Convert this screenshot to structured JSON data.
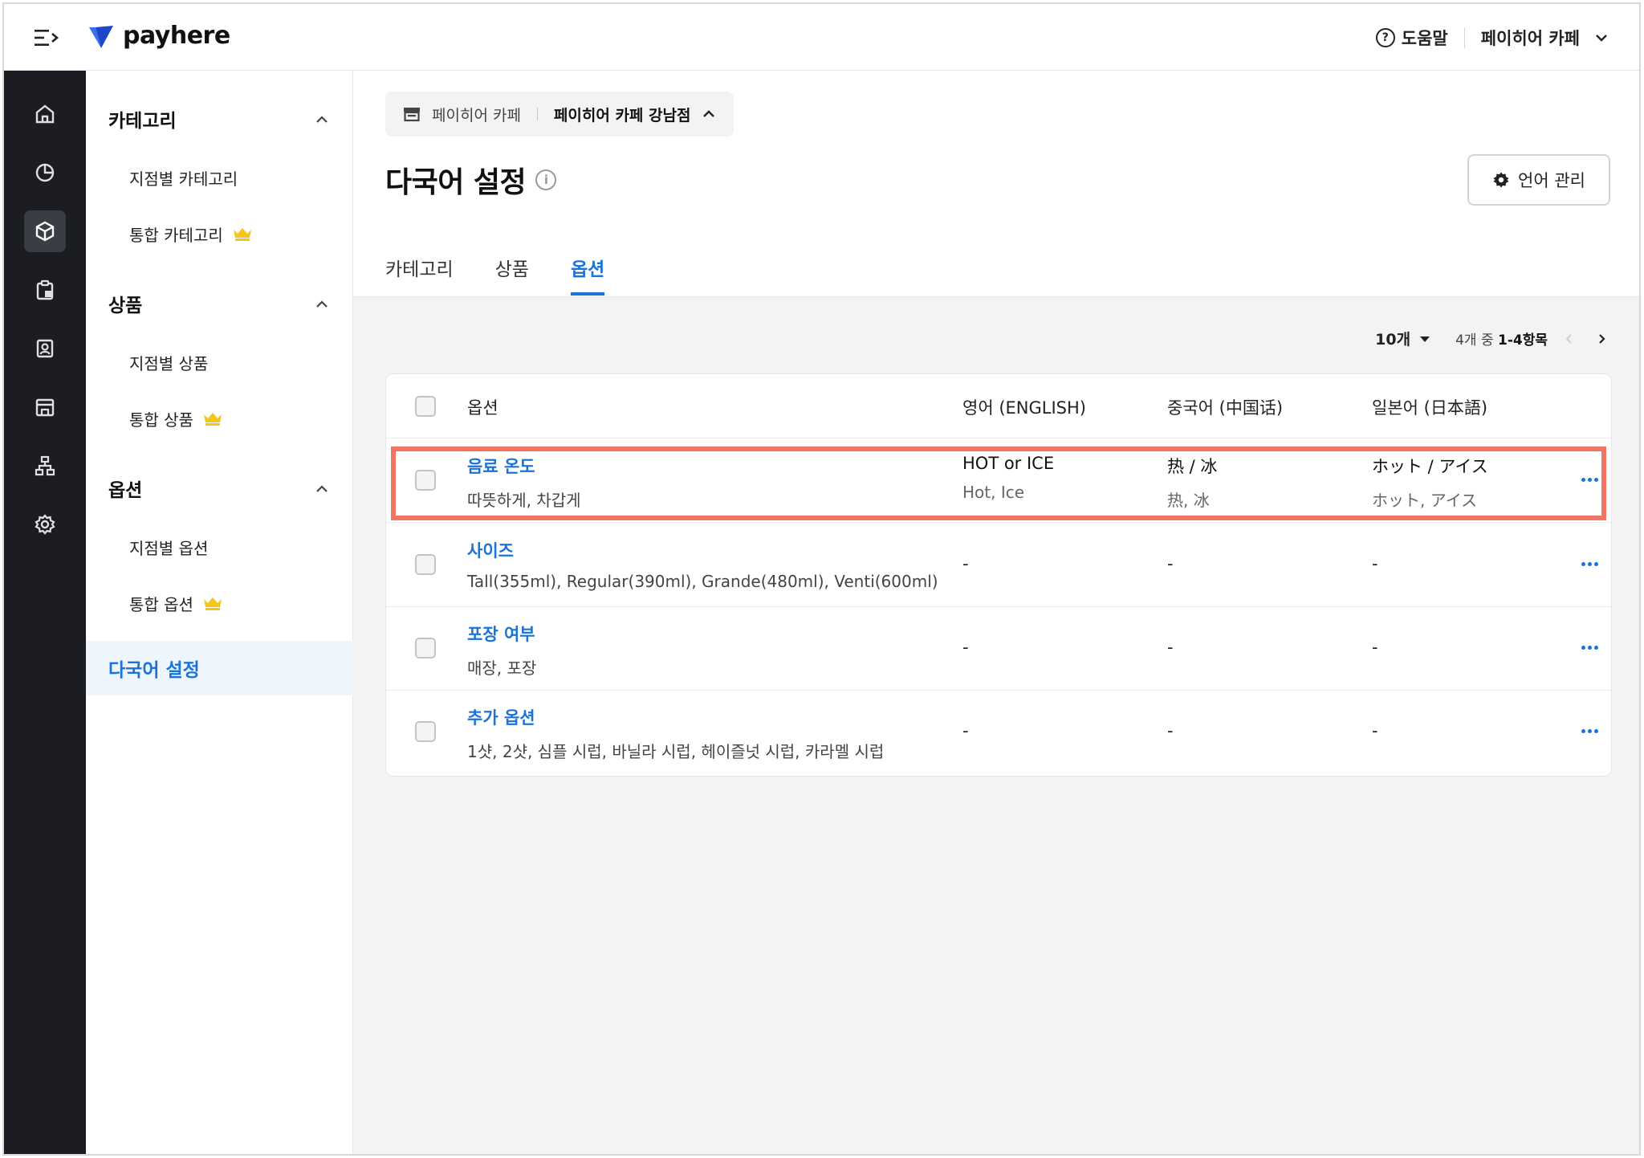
{
  "header": {
    "brand": "payhere",
    "help_label": "도움말",
    "store_switch_label": "페이히어 카페",
    "help_glyph": "?"
  },
  "rail": {
    "icons": [
      "home-icon",
      "pie-chart-icon",
      "box-icon",
      "clipboard-icon",
      "contact-icon",
      "store-icon",
      "org-chart-icon",
      "settings-icon"
    ]
  },
  "sidenav": {
    "groups": [
      {
        "label": "카테고리",
        "items": [
          {
            "label": "지점별 카테고리"
          },
          {
            "label": "통합 카테고리",
            "premium": true
          }
        ]
      },
      {
        "label": "상품",
        "items": [
          {
            "label": "지점별 상품"
          },
          {
            "label": "통합 상품",
            "premium": true
          }
        ]
      },
      {
        "label": "옵션",
        "items": [
          {
            "label": "지점별 옵션"
          },
          {
            "label": "통합 옵션",
            "premium": true
          }
        ]
      }
    ],
    "active_item": "다국어 설정"
  },
  "main": {
    "store_breadcrumb": {
      "parent": "페이히어 카페",
      "current": "페이히어 카페 강남점"
    },
    "title": "다국어 설정",
    "info_glyph": "i",
    "lang_manage_label": "언어 관리",
    "tabs": [
      {
        "label": "카테고리",
        "active": false
      },
      {
        "label": "상품",
        "active": false
      },
      {
        "label": "옵션",
        "active": true
      }
    ],
    "pager": {
      "per_page": "10개",
      "range_prefix": "4개 중",
      "range": "1-4항목"
    },
    "table": {
      "columns": [
        "옵션",
        "영어 (ENGLISH)",
        "중국어 (中国话)",
        "일본어 (日本語)"
      ],
      "rows": [
        {
          "name": "음료 온도",
          "values": "따뜻하게, 차갑게",
          "en": "HOT or ICE",
          "en_sub": "Hot, Ice",
          "zh": "热 / 冰",
          "zh_sub": "热, 冰",
          "ja": "ホット / アイス",
          "ja_sub": "ホット, アイス",
          "highlighted": true
        },
        {
          "name": "사이즈",
          "values": "Tall(355ml), Regular(390ml), Grande(480ml), Venti(600ml)",
          "en": "-",
          "zh": "-",
          "ja": "-"
        },
        {
          "name": "포장 여부",
          "values": "매장, 포장",
          "en": "-",
          "zh": "-",
          "ja": "-"
        },
        {
          "name": "추가 옵션",
          "values": "1샷, 2샷, 심플 시럽, 바닐라 시럽, 헤이즐넛 시럽, 카라멜 시럽",
          "en": "-",
          "zh": "-",
          "ja": "-"
        }
      ]
    }
  },
  "colors": {
    "accent": "#1a73d9",
    "rail_bg": "#1b1d22",
    "highlight": "#f27564",
    "crown": "#f5c518"
  }
}
